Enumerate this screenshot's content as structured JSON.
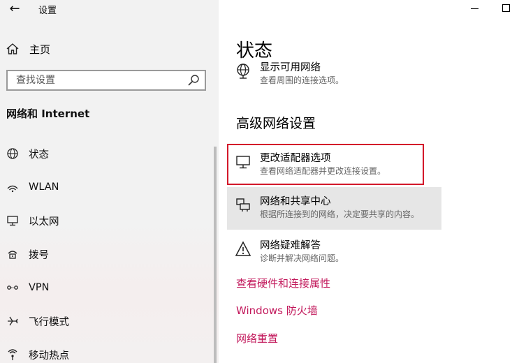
{
  "window": {
    "title": "设置",
    "back_icon": "back-arrow-icon",
    "minimize_icon": "minimize-icon",
    "maximize_icon": "maximize-icon"
  },
  "sidebar": {
    "home_label": "主页",
    "search_placeholder": "查找设置",
    "section_title": "网络和 Internet",
    "items": [
      {
        "label": "状态",
        "icon": "globe-icon"
      },
      {
        "label": "WLAN",
        "icon": "wifi-icon"
      },
      {
        "label": "以太网",
        "icon": "ethernet-icon"
      },
      {
        "label": "拨号",
        "icon": "dialup-icon"
      },
      {
        "label": "VPN",
        "icon": "vpn-icon"
      },
      {
        "label": "飞行模式",
        "icon": "airplane-icon"
      },
      {
        "label": "移动热点",
        "icon": "hotspot-icon"
      }
    ]
  },
  "main": {
    "title": "状态",
    "show_networks": {
      "title": "显示可用网络",
      "desc": "查看周围的连接选项。"
    },
    "advanced_title": "高级网络设置",
    "adapter": {
      "title": "更改适配器选项",
      "desc": "查看网络适配器并更改连接设置。"
    },
    "sharing_center": {
      "title": "网络和共享中心",
      "desc": "根据所连接到的网络，决定要共享的内容。"
    },
    "troubleshoot": {
      "title": "网络疑难解答",
      "desc": "诊断并解决网络问题。"
    },
    "links": [
      "查看硬件和连接属性",
      "Windows 防火墙",
      "网络重置"
    ]
  },
  "colors": {
    "link": "#c2185b",
    "highlight_border": "#d3182a",
    "hover_bg": "#e6e6e6"
  }
}
